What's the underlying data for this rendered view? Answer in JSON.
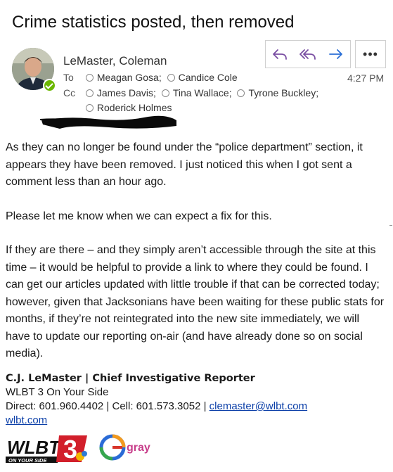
{
  "email": {
    "subject": "Crime statistics posted, then removed",
    "sender": "LeMaster, Coleman",
    "to_label": "To",
    "cc_label": "Cc",
    "to": [
      "Meagan Gosa;",
      "Candice Cole"
    ],
    "cc_line1": [
      "James Davis;",
      "Tina Wallace;",
      "Tyrone Buckley;"
    ],
    "cc_line2": [
      "Roderick Holmes"
    ],
    "time": "4:27 PM",
    "more_label": "•••"
  },
  "body": {
    "p1": "As they can no longer be found under the “police department” section, it appears they have been removed. I just noticed this when I got sent a comment less than an hour ago.",
    "p2": "Please let me know when we can expect a fix for this.",
    "p3": "If they are there – and they simply aren’t accessible through the site at this time – it would be helpful to provide a link to where they could be found. I can get our articles updated with little trouble if that can be corrected today; however, given that Jacksonians have been waiting for these public stats for months, if they’re not reintegrated into the new site immediately, we will have to update our reporting on-air (and have already done so on social media)."
  },
  "signature": {
    "name_title": "C.J. LeMaster | Chief Investigative Reporter",
    "org": "WLBT 3 On Your Side",
    "phones": "Direct: 601.960.4402 | Cell: 601.573.3052 | ",
    "email": "clemaster@wlbt.com",
    "website": "wlbt.com"
  },
  "logos": {
    "wlbt": "WLBT",
    "wlbt_tagline": "ON YOUR SIDE",
    "channel": "3",
    "gray": "gray"
  },
  "colors": {
    "accent": "#7a4fa3",
    "link": "#0b3fa8",
    "presence": "#6bb700"
  }
}
